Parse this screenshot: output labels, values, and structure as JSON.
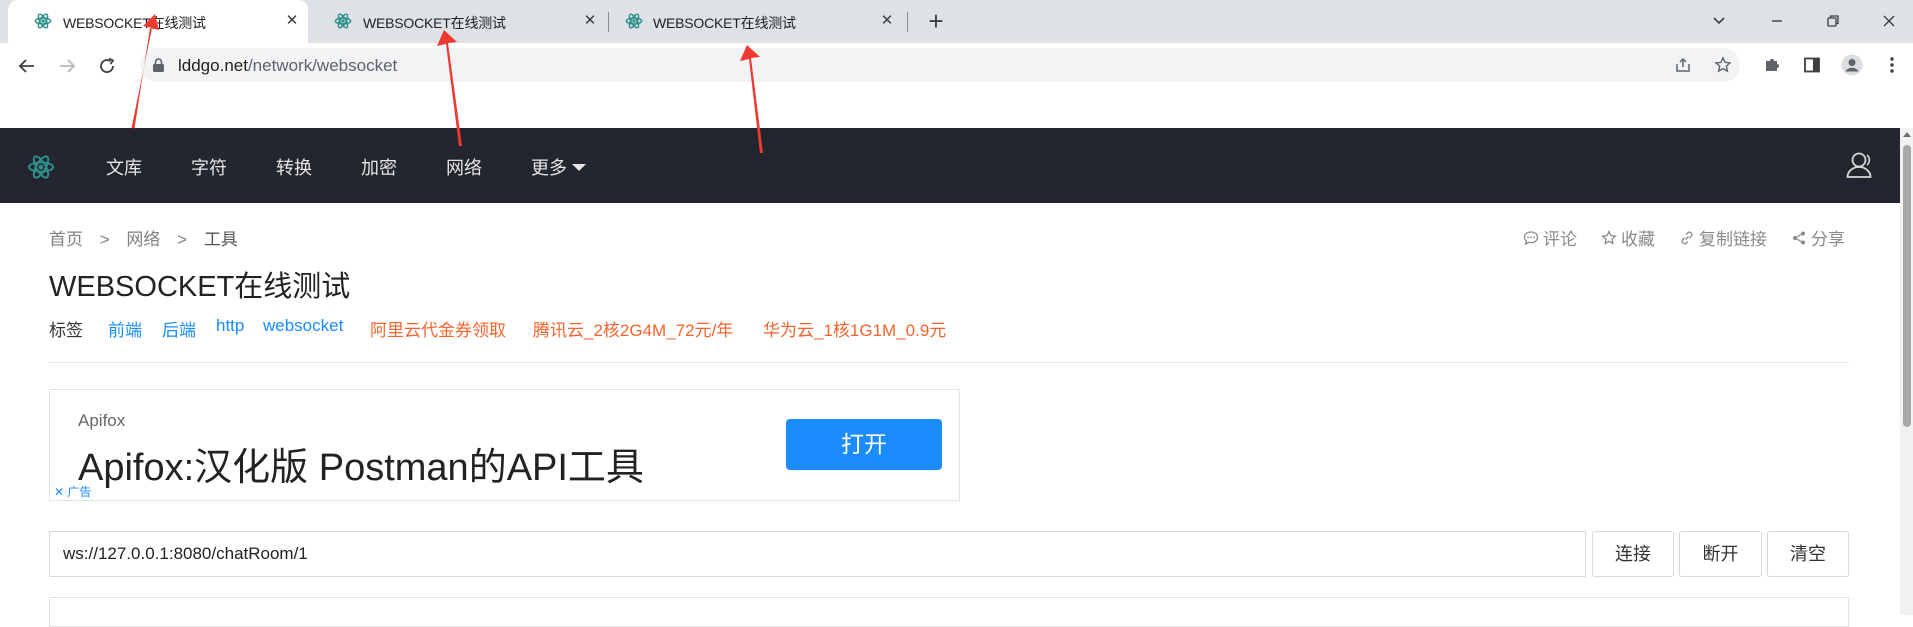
{
  "browser": {
    "tabs": [
      {
        "title": "WEBSOCKET在线测试",
        "active": true
      },
      {
        "title": "WEBSOCKET在线测试",
        "active": false
      },
      {
        "title": "WEBSOCKET在线测试",
        "active": false
      }
    ],
    "close_glyph": "✕",
    "new_tab_glyph": "+",
    "url_host": "lddgo.net",
    "url_path": "/network/websocket"
  },
  "site_nav": {
    "items": [
      "文库",
      "字符",
      "转换",
      "加密",
      "网络",
      "更多"
    ]
  },
  "breadcrumb": {
    "items": [
      "首页",
      "网络",
      "工具"
    ],
    "separator": ">"
  },
  "actions": {
    "comment": "评论",
    "favorite": "收藏",
    "copy_link": "复制链接",
    "share": "分享"
  },
  "page": {
    "title": "WEBSOCKET在线测试",
    "tags_label": "标签",
    "tags": [
      "前端",
      "后端",
      "http",
      "websocket"
    ],
    "promo_tags": [
      "阿里云代金券领取",
      "腾讯云_2核2G4M_72元/年",
      "华为云_1核1G1M_0.9元"
    ]
  },
  "ad": {
    "brand": "Apifox",
    "headline": "Apifox:汉化版 Postman的API工具",
    "button": "打开",
    "label": "✕ 广告"
  },
  "websocket": {
    "url_value": "ws://127.0.0.1:8080/chatRoom/1",
    "connect_label": "连接",
    "disconnect_label": "断开",
    "clear_label": "清空"
  },
  "colors": {
    "tabstrip": "#dee1e6",
    "nav_bg": "#23262e",
    "tag_blue": "#1a8cff",
    "promo_red": "#f5642d",
    "annotation_red": "#ee3a30",
    "favicon_teal": "#2f8f8a"
  }
}
